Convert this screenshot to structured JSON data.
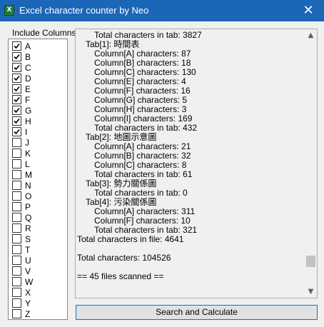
{
  "window": {
    "title": "Excel character counter by Neo",
    "app_icon_glyph": "X",
    "icon": "excel-icon",
    "close_glyph": "✕",
    "accent_color": "#1c66b8"
  },
  "columns_panel": {
    "label": "Include Columns",
    "items": [
      {
        "label": "A",
        "checked": true
      },
      {
        "label": "B",
        "checked": true
      },
      {
        "label": "C",
        "checked": true
      },
      {
        "label": "D",
        "checked": true
      },
      {
        "label": "E",
        "checked": true
      },
      {
        "label": "F",
        "checked": true
      },
      {
        "label": "G",
        "checked": true
      },
      {
        "label": "H",
        "checked": true
      },
      {
        "label": "I",
        "checked": true
      },
      {
        "label": "J",
        "checked": false
      },
      {
        "label": "K",
        "checked": false
      },
      {
        "label": "L",
        "checked": false
      },
      {
        "label": "M",
        "checked": false
      },
      {
        "label": "N",
        "checked": false
      },
      {
        "label": "O",
        "checked": false
      },
      {
        "label": "P",
        "checked": false
      },
      {
        "label": "Q",
        "checked": false
      },
      {
        "label": "R",
        "checked": false
      },
      {
        "label": "S",
        "checked": false
      },
      {
        "label": "T",
        "checked": false
      },
      {
        "label": "U",
        "checked": false
      },
      {
        "label": "V",
        "checked": false
      },
      {
        "label": "W",
        "checked": false
      },
      {
        "label": "X",
        "checked": false
      },
      {
        "label": "Y",
        "checked": false
      },
      {
        "label": "Z",
        "checked": false
      }
    ]
  },
  "output": {
    "lines": [
      {
        "indent": 2,
        "text": "Total characters in tab: 3827"
      },
      {
        "indent": 1,
        "text": "Tab[1]: 時間表"
      },
      {
        "indent": 2,
        "text": "Column[A] characters: 87"
      },
      {
        "indent": 2,
        "text": "Column[B] characters: 18"
      },
      {
        "indent": 2,
        "text": "Column[C] characters: 130"
      },
      {
        "indent": 2,
        "text": "Column[E] characters: 4"
      },
      {
        "indent": 2,
        "text": "Column[F] characters: 16"
      },
      {
        "indent": 2,
        "text": "Column[G] characters: 5"
      },
      {
        "indent": 2,
        "text": "Column[H] characters: 3"
      },
      {
        "indent": 2,
        "text": "Column[I] characters: 169"
      },
      {
        "indent": 2,
        "text": "Total characters in tab: 432"
      },
      {
        "indent": 1,
        "text": "Tab[2]: 地圖示意圖"
      },
      {
        "indent": 2,
        "text": "Column[A] characters: 21"
      },
      {
        "indent": 2,
        "text": "Column[B] characters: 32"
      },
      {
        "indent": 2,
        "text": "Column[C] characters: 8"
      },
      {
        "indent": 2,
        "text": "Total characters in tab: 61"
      },
      {
        "indent": 1,
        "text": "Tab[3]: 勢力關係圖"
      },
      {
        "indent": 2,
        "text": "Total characters in tab: 0"
      },
      {
        "indent": 1,
        "text": "Tab[4]: 污染關係圖"
      },
      {
        "indent": 2,
        "text": "Column[A] characters: 311"
      },
      {
        "indent": 2,
        "text": "Column[F] characters: 10"
      },
      {
        "indent": 2,
        "text": "Total characters in tab: 321"
      },
      {
        "indent": 0,
        "text": "Total characters in file: 4641"
      },
      {
        "indent": 0,
        "text": ""
      },
      {
        "indent": 0,
        "text": "Total characters: 104526"
      },
      {
        "indent": 0,
        "text": ""
      },
      {
        "indent": 0,
        "text": "== 45 files scanned =="
      }
    ],
    "scroll_position": 0.92,
    "scroll_up_icon": "▲",
    "scroll_down_icon": "▼"
  },
  "actions": {
    "search_label": "Search and Calculate"
  }
}
